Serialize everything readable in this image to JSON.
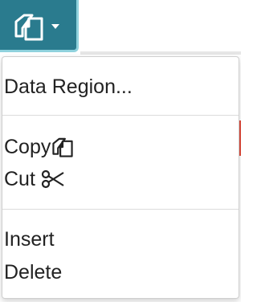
{
  "toolbar": {
    "copy_button_icon": "copy-icon",
    "dropdown_icon": "caret-down-icon",
    "button_color": "#2a7b8e",
    "focus_ring_color": "#8fd2dd"
  },
  "menu": {
    "items": [
      {
        "label": "Data Region...",
        "icon": null
      },
      {
        "label": "Copy",
        "icon": "copy-icon"
      },
      {
        "label": "Cut",
        "icon": "scissors-icon"
      },
      {
        "label": "Insert",
        "icon": null
      },
      {
        "label": "Delete",
        "icon": null
      }
    ]
  }
}
